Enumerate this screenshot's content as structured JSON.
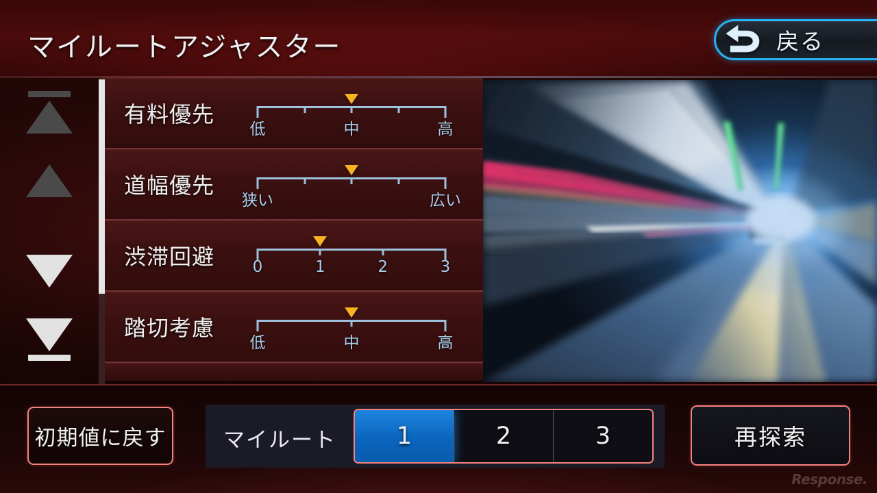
{
  "header": {
    "title": "マイルートアジャスター",
    "back_label": "戻る",
    "back_icon": "undo-arrow-icon",
    "accent_cyan": "#25b4f5"
  },
  "scroll_rail": {
    "top_label": "scroll-to-top",
    "up_label": "scroll-up",
    "down_label": "scroll-down",
    "bottom_label": "scroll-to-bottom"
  },
  "settings": {
    "rows": [
      {
        "label": "有料優先",
        "ticks": 5,
        "marker_index": 2,
        "tick_labels": [
          {
            "index": 0,
            "text": "低"
          },
          {
            "index": 2,
            "text": "中"
          },
          {
            "index": 4,
            "text": "高"
          }
        ]
      },
      {
        "label": "道幅優先",
        "ticks": 5,
        "marker_index": 2,
        "tick_labels": [
          {
            "index": 0,
            "text": "狭い"
          },
          {
            "index": 4,
            "text": "広い"
          }
        ]
      },
      {
        "label": "渋滞回避",
        "ticks": 4,
        "marker_index": 1,
        "tick_labels": [
          {
            "index": 0,
            "text": "0"
          },
          {
            "index": 1,
            "text": "1"
          },
          {
            "index": 2,
            "text": "2"
          },
          {
            "index": 3,
            "text": "3"
          }
        ]
      },
      {
        "label": "踏切考慮",
        "ticks": 3,
        "marker_index": 1,
        "tick_labels": [
          {
            "index": 0,
            "text": "低"
          },
          {
            "index": 1,
            "text": "中"
          },
          {
            "index": 2,
            "text": "高"
          }
        ]
      }
    ]
  },
  "footer": {
    "reset_label": "初期値に戻す",
    "myroute_label": "マイルート",
    "myroute_options": [
      "1",
      "2",
      "3"
    ],
    "myroute_selected": "1",
    "research_label": "再探索",
    "accent_pink": "#f7837f",
    "accent_blue": "#0a65bd"
  },
  "watermark": {
    "text": "Response."
  }
}
